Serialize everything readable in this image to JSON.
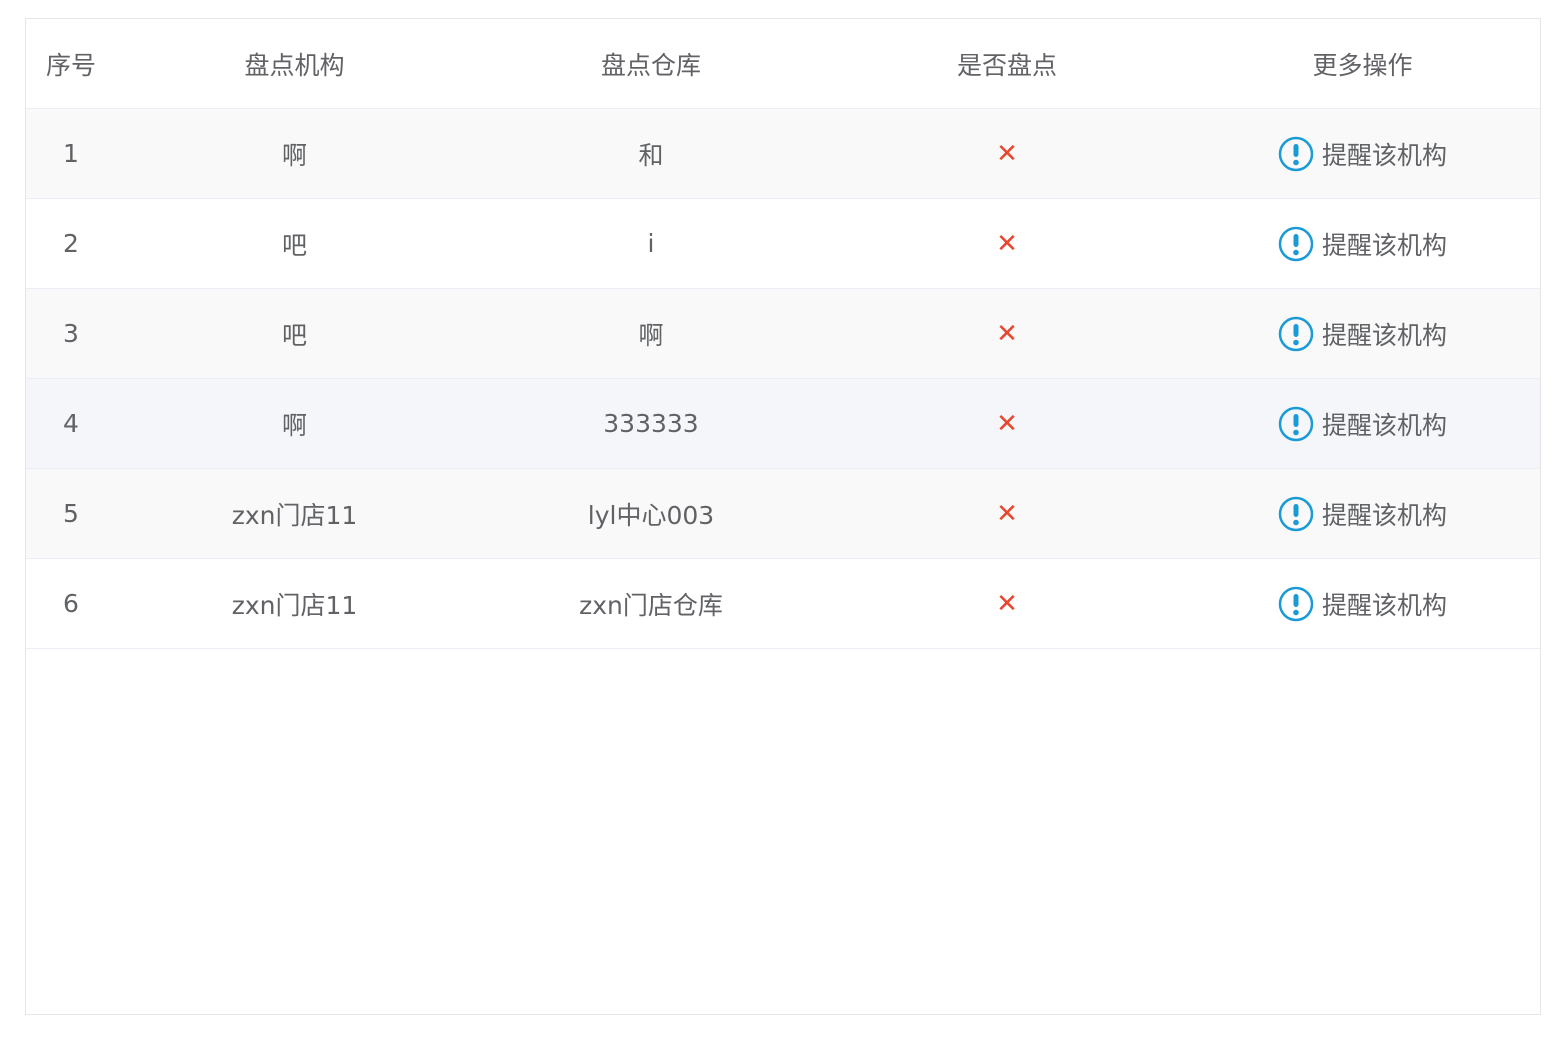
{
  "columns": {
    "index": "序号",
    "org": "盘点机构",
    "warehouse": "盘点仓库",
    "done": "是否盘点",
    "more": "更多操作"
  },
  "rows": [
    {
      "index": "1",
      "org": "啊",
      "warehouse": "和",
      "done": "✕",
      "action": "提醒该机构"
    },
    {
      "index": "2",
      "org": "吧",
      "warehouse": "i",
      "done": "✕",
      "action": "提醒该机构"
    },
    {
      "index": "3",
      "org": "吧",
      "warehouse": "啊",
      "done": "✕",
      "action": "提醒该机构"
    },
    {
      "index": "4",
      "org": "啊",
      "warehouse": "333333",
      "done": "✕",
      "action": "提醒该机构"
    },
    {
      "index": "5",
      "org": "zxn门店11",
      "warehouse": "lyl中心003",
      "done": "✕",
      "action": "提醒该机构"
    },
    {
      "index": "6",
      "org": "zxn门店11",
      "warehouse": "zxn门店仓库",
      "done": "✕",
      "action": "提醒该机构"
    }
  ],
  "colors": {
    "cross": "#e8472f",
    "remind_icon": "#1a9bd7",
    "text": "#606266",
    "stripe": "#f9f9f9"
  },
  "icons": {
    "not_done": "close-icon",
    "remind": "exclamation-circle-icon"
  }
}
